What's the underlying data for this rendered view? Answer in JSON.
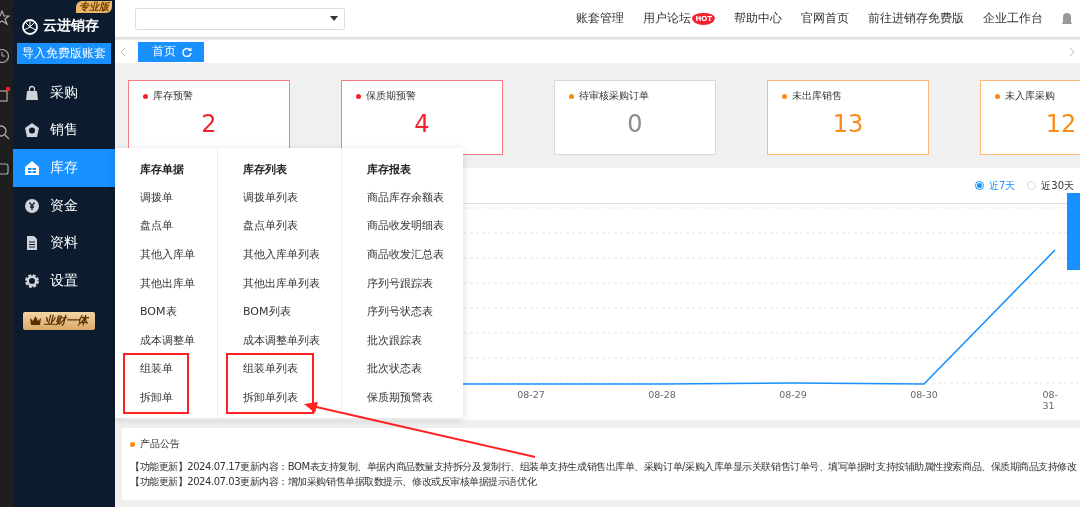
{
  "sidebar": {
    "logo": "云进销存",
    "edition_badge": "专业版",
    "import_button": "导入免费版账套",
    "items": [
      {
        "label": "采购",
        "selected": false
      },
      {
        "label": "销售",
        "selected": false
      },
      {
        "label": "库存",
        "selected": true
      },
      {
        "label": "资金",
        "selected": false
      },
      {
        "label": "资料",
        "selected": false
      },
      {
        "label": "设置",
        "selected": false
      }
    ],
    "promo_badge": "业财一体"
  },
  "header": {
    "links": [
      {
        "label": "账套管理"
      },
      {
        "label": "用户论坛",
        "badge": "HOT"
      },
      {
        "label": "帮助中心"
      },
      {
        "label": "官网首页"
      },
      {
        "label": "前往进销存免费版"
      },
      {
        "label": "企业工作台"
      }
    ]
  },
  "tabs": [
    {
      "label": "首页",
      "selected": true
    }
  ],
  "cards": [
    {
      "label": "库存预警",
      "value": "2",
      "color": "#f5222d",
      "highlighted": true
    },
    {
      "label": "保质期预警",
      "value": "4",
      "color": "#f5222d",
      "highlighted": true
    },
    {
      "label": "待审核采购订单",
      "value": "0",
      "color": "#fa8c16",
      "highlighted": false
    },
    {
      "label": "未出库销售",
      "value": "13",
      "color": "#fa8c16",
      "highlighted": true
    },
    {
      "label": "未入库采购",
      "value": "12",
      "color": "#fa8c16",
      "highlighted": true
    }
  ],
  "chart": {
    "ranges": [
      {
        "label": "近7天",
        "selected": true
      },
      {
        "label": "近30天",
        "selected": false
      }
    ],
    "x_labels": [
      "08-27",
      "08-28",
      "08-29",
      "08-30",
      "08-31"
    ]
  },
  "menu": {
    "columns": [
      {
        "title": "库存单据",
        "items": [
          "调拨单",
          "盘点单",
          "其他入库单",
          "其他出库单",
          "BOM表",
          "成本调整单"
        ],
        "highlighted_items": [
          "组装单",
          "拆卸单"
        ]
      },
      {
        "title": "库存列表",
        "items": [
          "调拨单列表",
          "盘点单列表",
          "其他入库单列表",
          "其他出库单列表",
          "BOM列表",
          "成本调整单列表"
        ],
        "highlighted_items": [
          "组装单列表",
          "拆卸单列表"
        ]
      },
      {
        "title": "库存报表",
        "items": [
          "商品库存余额表",
          "商品收发明细表",
          "商品收发汇总表",
          "序列号跟踪表",
          "序列号状态表",
          "批次跟踪表",
          "批次状态表",
          "保质期预警表"
        ]
      }
    ]
  },
  "announcement": {
    "title": "产品公告",
    "lines": [
      "【功能更新】2024.07.17更新内容：BOM表支持复制、单据内商品数量支持拆分及复制行、组装单支持生成销售出库单、采购订单/采购入库单显示关联销售订单号、填写单据时支持按辅助属性搜索商品、保质期商品支持修改",
      "【功能更新】2024.07.03更新内容：增加采购销售单据取数提示、修改或反审核单据提示语优化"
    ]
  }
}
